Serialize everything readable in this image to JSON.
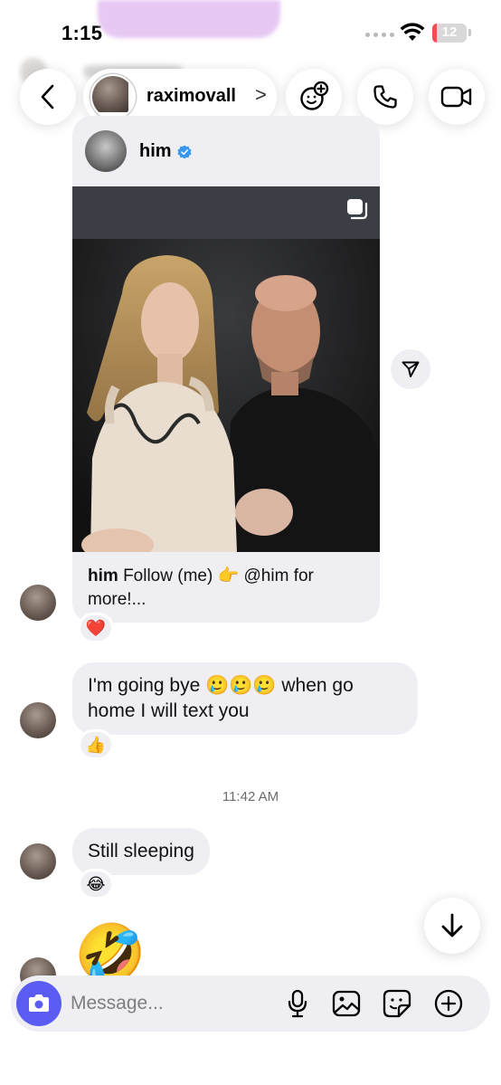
{
  "status_bar": {
    "time": "1:15",
    "battery": "12",
    "battery_level": 0.12,
    "battery_color": "#ef4f4f"
  },
  "header": {
    "contact_name": "raximovall",
    "chevron": ">"
  },
  "shared_post": {
    "author": "him",
    "caption_author": "him",
    "caption_text": "Follow (me) 👉 @him for more!...",
    "reaction": "❤️"
  },
  "messages": [
    {
      "text": "I'm  going bye 🥲🥲🥲 when go home I will text you",
      "reaction": "👍"
    },
    {
      "text": "Still sleeping",
      "reaction": "😂"
    }
  ],
  "timestamp": "11:42 AM",
  "last_emoji": "🤣",
  "composer": {
    "placeholder": "Message..."
  },
  "colors": {
    "accent": "#5b5cf4",
    "bubble": "#efeff3",
    "verified": "#3897f0"
  }
}
